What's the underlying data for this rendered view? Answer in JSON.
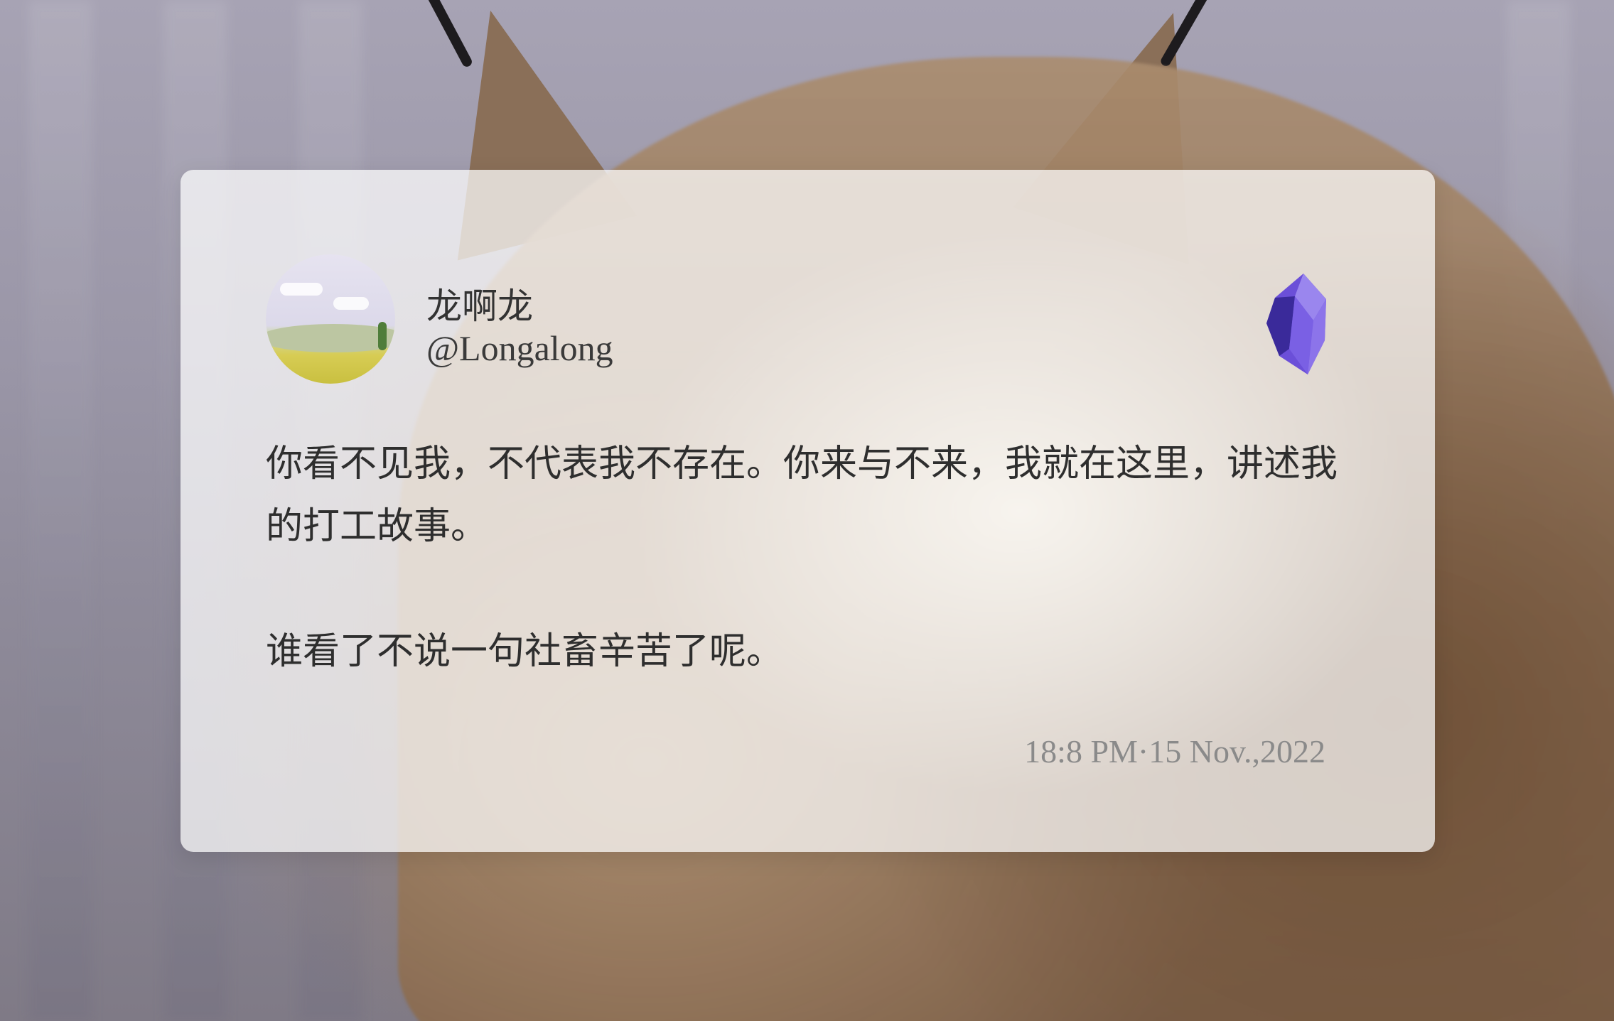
{
  "post": {
    "display_name": "龙啊龙",
    "handle": "@Longalong",
    "paragraphs": [
      "你看不见我，不代表我不存在。你来与不来，我就在这里，讲述我的打工故事。",
      "谁看了不说一句社畜辛苦了呢。"
    ],
    "timestamp": "18:8 PM·15 Nov.,2022"
  },
  "icons": {
    "avatar": "landscape-avatar-icon",
    "brand": "obsidian-crystal-icon"
  },
  "colors": {
    "brand_purple": "#6b4fd8",
    "brand_purple_dark": "#3a2a9a",
    "brand_purple_light": "#9a86ee",
    "card_bg": "rgba(255,255,255,0.72)",
    "text_primary": "#2e2e2e",
    "text_muted": "#8a8a8a"
  }
}
